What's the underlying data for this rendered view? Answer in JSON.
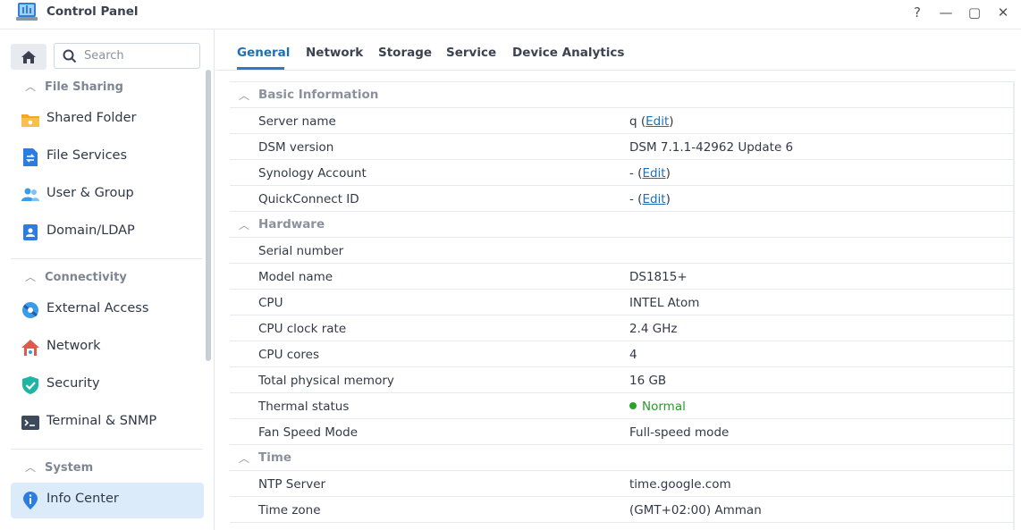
{
  "window": {
    "title": "Control Panel",
    "help_glyph": "?",
    "minimize_glyph": "—",
    "maximize_glyph": "▢",
    "close_glyph": "✕"
  },
  "sidebar": {
    "search_placeholder": "Search",
    "groups": [
      {
        "label": "File Sharing",
        "items": [
          {
            "label": "Shared Folder",
            "icon": "shared-folder-icon"
          },
          {
            "label": "File Services",
            "icon": "file-services-icon"
          },
          {
            "label": "User & Group",
            "icon": "user-group-icon"
          },
          {
            "label": "Domain/LDAP",
            "icon": "domain-ldap-icon"
          }
        ]
      },
      {
        "label": "Connectivity",
        "items": [
          {
            "label": "External Access",
            "icon": "external-access-icon"
          },
          {
            "label": "Network",
            "icon": "network-icon"
          },
          {
            "label": "Security",
            "icon": "security-icon"
          },
          {
            "label": "Terminal & SNMP",
            "icon": "terminal-icon"
          }
        ]
      },
      {
        "label": "System",
        "items": [
          {
            "label": "Info Center",
            "icon": "info-icon",
            "active": true
          }
        ]
      }
    ]
  },
  "tabs": [
    {
      "label": "General",
      "active": true
    },
    {
      "label": "Network"
    },
    {
      "label": "Storage"
    },
    {
      "label": "Service"
    },
    {
      "label": "Device Analytics"
    }
  ],
  "sections": {
    "basic": {
      "title": "Basic Information",
      "server_name": {
        "key": "Server name",
        "value": "q",
        "edit": "Edit"
      },
      "dsm_version": {
        "key": "DSM version",
        "value": "DSM 7.1.1-42962 Update 6"
      },
      "synology_account": {
        "key": "Synology Account",
        "value": "-",
        "edit": "Edit"
      },
      "quickconnect": {
        "key": "QuickConnect ID",
        "value": "-",
        "edit": "Edit"
      }
    },
    "hardware": {
      "title": "Hardware",
      "serial": {
        "key": "Serial number",
        "value": ""
      },
      "model": {
        "key": "Model name",
        "value": "DS1815+"
      },
      "cpu": {
        "key": "CPU",
        "value": "INTEL Atom"
      },
      "clock": {
        "key": "CPU clock rate",
        "value": "2.4 GHz"
      },
      "cores": {
        "key": "CPU cores",
        "value": "4"
      },
      "memory": {
        "key": "Total physical memory",
        "value": "16 GB"
      },
      "thermal": {
        "key": "Thermal status",
        "value": "Normal"
      },
      "fan": {
        "key": "Fan Speed Mode",
        "value": "Full-speed mode"
      }
    },
    "time": {
      "title": "Time",
      "ntp": {
        "key": "NTP Server",
        "value": "time.google.com"
      },
      "tz": {
        "key": "Time zone",
        "value": "(GMT+02:00) Amman"
      }
    }
  },
  "colors": {
    "accent": "#1f6fb5",
    "status_normal": "#29a329",
    "active_nav_bg": "#dcebfa"
  }
}
